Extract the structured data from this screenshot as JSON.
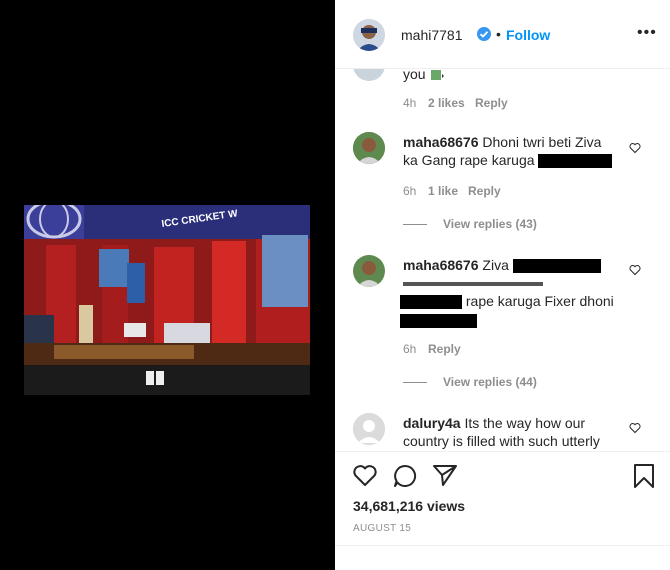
{
  "post": {
    "username": "mahi7781",
    "follow_label": "Follow",
    "dot": "•",
    "more": "•••"
  },
  "partial_comment": {
    "text": "you",
    "time": "4h",
    "likes": "2 likes",
    "reply": "Reply"
  },
  "comments": [
    {
      "username": "maha68676",
      "text_a": "Dhoni twri beti Ziva",
      "text_b": "ka Gang rape karuga",
      "time": "6h",
      "likes": "1 like",
      "reply": "Reply",
      "view_replies": "View replies (43)"
    },
    {
      "username": "maha68676",
      "text_a": "Ziva",
      "text_b": "rape karuga Fixer dhoni",
      "time": "6h",
      "reply": "Reply",
      "view_replies": "View replies (44)"
    },
    {
      "username": "dalury4a",
      "text_a": "Its the way how our",
      "text_b": "country is filled with such utterly"
    }
  ],
  "stats": {
    "views": "34,681,216 views",
    "date": "AUGUST 15"
  },
  "photo": {
    "banner_text": "ICC CRICKET W"
  },
  "colors": {
    "link": "#0095f6",
    "verified": "#3897f0",
    "text": "#262626",
    "muted": "#8e8e8e"
  }
}
